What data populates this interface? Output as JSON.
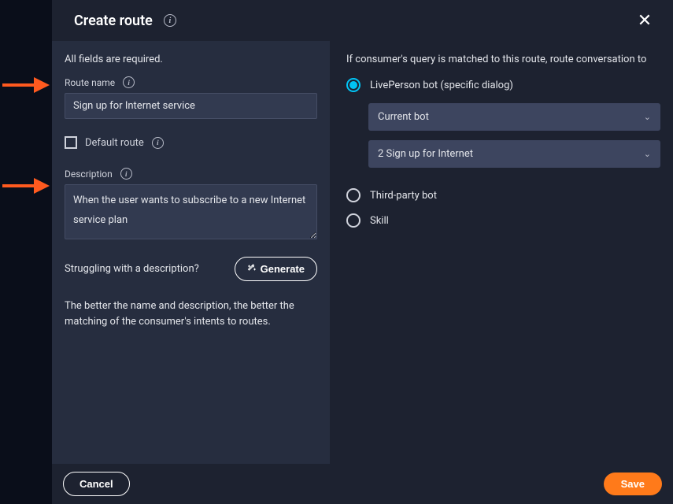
{
  "dialog": {
    "title": "Create route",
    "required_text": "All fields are required.",
    "route_name_label": "Route name",
    "route_name_value": "Sign up for Internet service",
    "default_route_label": "Default route",
    "description_label": "Description",
    "description_value": "When the user wants to subscribe to a new Internet service plan",
    "struggling_text": "Struggling with a description?",
    "generate_label": "Generate",
    "hint_text": "The better the name and description, the better the matching of the consumer's intents to routes.",
    "route_to_text": "If consumer's query is matched to this route, route conversation to",
    "options": {
      "liveperson": "LivePerson bot (specific dialog)",
      "thirdparty": "Third-party bot",
      "skill": "Skill"
    },
    "select_bot": "Current bot",
    "select_dialog": "2 Sign up for Internet",
    "cancel_label": "Cancel",
    "save_label": "Save"
  }
}
